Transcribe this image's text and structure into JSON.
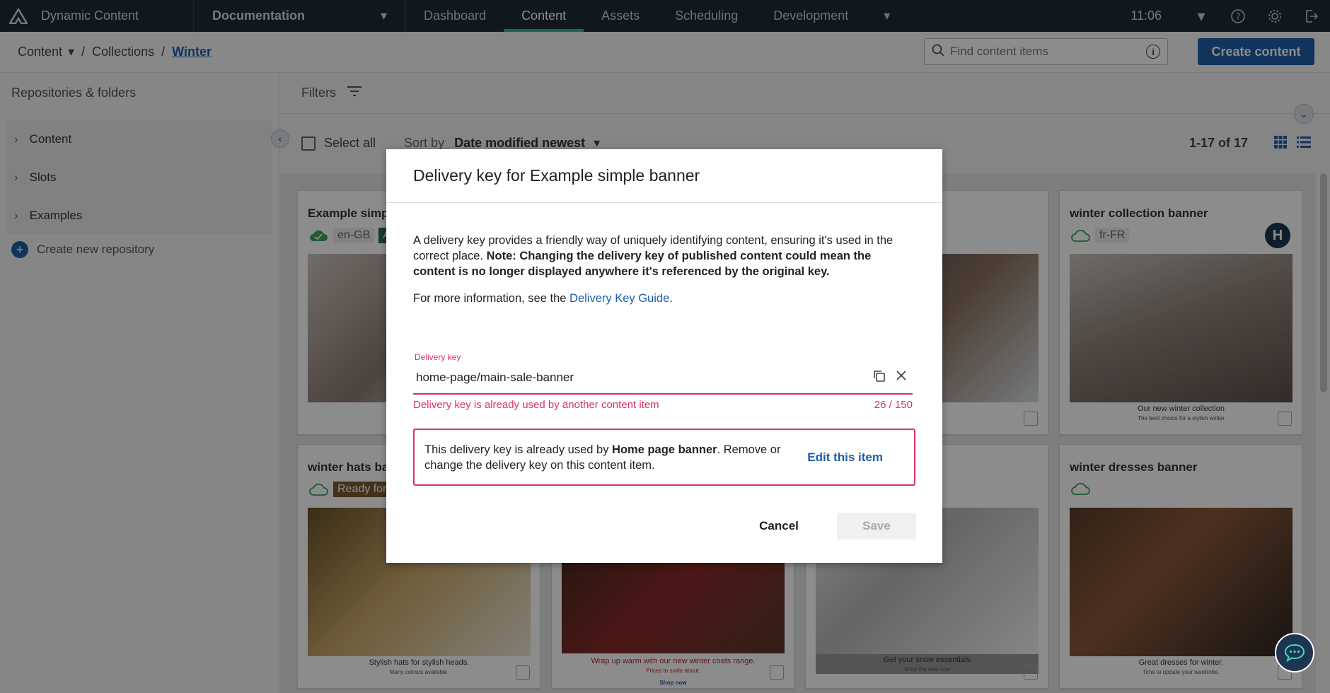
{
  "app": {
    "title": "Dynamic Content",
    "hub": "Documentation",
    "nav_tabs": [
      "Dashboard",
      "Content",
      "Assets",
      "Scheduling",
      "Development"
    ],
    "active_tab": "Content",
    "clock": "11:06",
    "icons": [
      "help-icon",
      "gear-icon",
      "logout-icon"
    ]
  },
  "breadcrumb": {
    "root": "Content",
    "middle": "Collections",
    "current": "Winter"
  },
  "search": {
    "placeholder": "Find content items"
  },
  "create_button": "Create content",
  "sidebar": {
    "title": "Repositories & folders",
    "items": [
      "Content",
      "Slots",
      "Examples"
    ],
    "new_repo": "Create new repository"
  },
  "filters": {
    "label": "Filters"
  },
  "toolbar": {
    "select_all": "Select all",
    "sort_label": "Sort by",
    "sort_value": "Date modified newest",
    "count": "1-17 of 17"
  },
  "cards": [
    {
      "title": "Example simple banner",
      "locale": "en-GB",
      "badge": "A",
      "status": "published",
      "caption": "",
      "sub": ""
    },
    {
      "title": "",
      "locale": "",
      "caption": "",
      "sub": ""
    },
    {
      "title": "",
      "locale": "",
      "caption": "",
      "sub": ""
    },
    {
      "title": "winter collection banner",
      "locale": "fr-FR",
      "avatar": "H",
      "caption": "Our new winter collection",
      "sub": "The best choice for a stylish winter"
    },
    {
      "title": "winter hats banner",
      "badge": "Ready for",
      "caption": "Stylish hats for stylish heads.",
      "sub": "Many colours available."
    },
    {
      "title": "",
      "caption": "Wrap up warm with our new winter coats range.",
      "sub": "Prices to smile about.",
      "cta": "Shop now"
    },
    {
      "title": "",
      "caption": "Get your snow essentials",
      "sub": "Shop the sale now"
    },
    {
      "title": "winter dresses banner",
      "caption": "Great dresses for winter.",
      "sub": "Time to update your wardrobe."
    }
  ],
  "modal": {
    "title": "Delivery key for Example simple banner",
    "intro": "A delivery key provides a friendly way of uniquely identifying content, ensuring it's used in the correct place.",
    "note": "Note: Changing the delivery key of published content could mean the content is no longer displayed anywhere it's referenced by the original key.",
    "more_info": "For more information, see the",
    "guide_link": "Delivery Key Guide",
    "field_label": "Delivery key",
    "field_value": "home-page/main-sale-banner",
    "error": "Delivery key is already used by another content item",
    "counter": "26 / 150",
    "conflict_pre": "This delivery key is already used by",
    "conflict_item": "Home page banner",
    "conflict_post": ". Remove or change the delivery key on this content item.",
    "edit_link": "Edit this item",
    "cancel": "Cancel",
    "save": "Save"
  },
  "colors": {
    "nav_bg": "#1e2a35",
    "accent": "#1e5fa8",
    "error": "#d9345e",
    "active_tab": "#2fb3a0"
  }
}
